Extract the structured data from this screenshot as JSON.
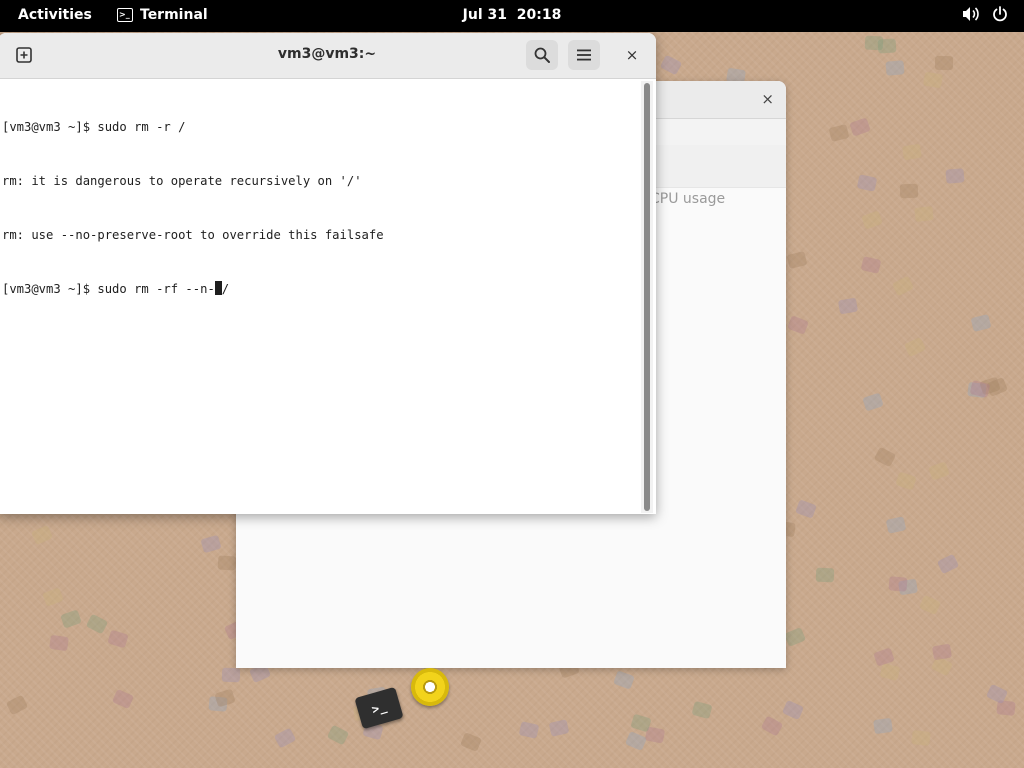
{
  "topbar": {
    "activities": "Activities",
    "app_name": "Terminal",
    "clock_date": "Jul 31",
    "clock_time": "20:18",
    "icons": [
      "volume-icon",
      "power-icon"
    ]
  },
  "background_window": {
    "close_glyph": "×",
    "cpu_label": "CPU usage"
  },
  "terminal": {
    "title": "vm3@vm3:~",
    "lines": [
      "[vm3@vm3 ~]$ sudo rm -r /",
      "rm: it is dangerous to operate recursively on '/'",
      "rm: use --no-preserve-root to override this failsafe"
    ],
    "current_prompt": "[vm3@vm3 ~]$ sudo rm -rf --n-",
    "current_after_cursor": "/",
    "close_glyph": "×"
  },
  "desktop": {
    "terminal_icon_glyph": ">_",
    "icons": [
      "terminal-app-icon",
      "disc-icon"
    ]
  },
  "colors": {
    "topbar": "#000000",
    "desktop": "#c9a98d",
    "terminal_bg": "#ffffff",
    "header_bg": "#ebebeb"
  }
}
